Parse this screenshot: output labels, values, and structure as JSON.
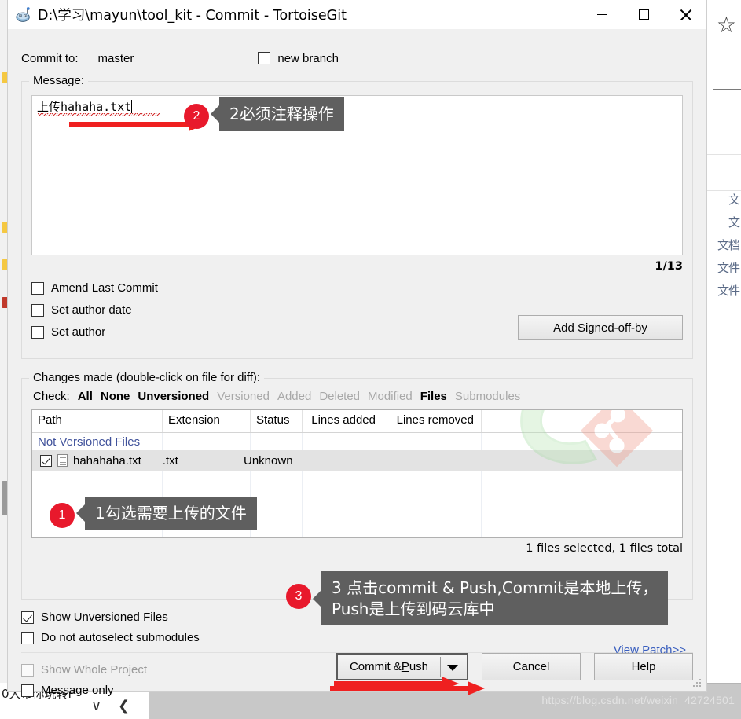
{
  "window": {
    "title": "D:\\学习\\mayun\\tool_kit - Commit - TortoiseGit",
    "app_icon": "tortoisegit-icon",
    "minimize_label": "minimize-icon",
    "maximize_label": "maximize-icon",
    "close_label": "close-icon"
  },
  "commit_to": {
    "label": "Commit to:",
    "branch": "master",
    "new_branch_label": "new branch",
    "new_branch_checked": false
  },
  "message": {
    "legend": "Message:",
    "value": "上传hahaha.txt",
    "counter": "1/13"
  },
  "options": {
    "amend_last_commit": "Amend Last Commit",
    "set_author_date": "Set author date",
    "set_author": "Set author",
    "add_signed_off_by": "Add Signed-off-by"
  },
  "changes": {
    "legend": "Changes made (double-click on file for diff):",
    "check_label": "Check:",
    "check_links": [
      {
        "label": "All",
        "state": "active"
      },
      {
        "label": "None",
        "state": "active"
      },
      {
        "label": "Unversioned",
        "state": "active"
      },
      {
        "label": "Versioned",
        "state": "dim"
      },
      {
        "label": "Added",
        "state": "dim"
      },
      {
        "label": "Deleted",
        "state": "dim"
      },
      {
        "label": "Modified",
        "state": "dim"
      },
      {
        "label": "Files",
        "state": "active"
      },
      {
        "label": "Submodules",
        "state": "dim"
      }
    ],
    "columns": [
      "Path",
      "Extension",
      "Status",
      "Lines added",
      "Lines removed"
    ],
    "group_header": "Not Versioned Files",
    "rows": [
      {
        "checked": true,
        "path": "hahahaha.txt",
        "extension": ".txt",
        "status": "Unknown",
        "lines_added": "",
        "lines_removed": ""
      }
    ],
    "files_total": "1 files selected, 1 files total",
    "view_patch": "View Patch>>"
  },
  "bottom_options": {
    "show_unversioned_files": {
      "label": "Show Unversioned Files",
      "checked": true,
      "disabled": false
    },
    "do_not_autoselect_submodules": {
      "label": "Do not autoselect submodules",
      "checked": false,
      "disabled": false
    },
    "show_whole_project": {
      "label": "Show Whole Project",
      "checked": false,
      "disabled": true
    },
    "message_only": {
      "label": "Message only",
      "checked": false,
      "disabled": false
    }
  },
  "actions": {
    "commit_push_prefix": "Commit & ",
    "commit_push_accel": "P",
    "commit_push_suffix": "ush",
    "dropdown_icon": "chevron-down-icon",
    "cancel": "Cancel",
    "help": "Help"
  },
  "annotations": [
    {
      "number": "1",
      "text": "1勾选需要上传的文件"
    },
    {
      "number": "2",
      "text": "2必须注释操作"
    },
    {
      "number": "3",
      "text": "3 点击commit & Push,Commit是本地上传，\nPush是上传到码云库中"
    }
  ],
  "backdrop": {
    "star_icon": "star-icon",
    "right_texts": [
      "文",
      "文",
      "文档",
      "文件",
      "文件"
    ],
    "taskbar_text": "0大带你玩转F",
    "dropdown_icon": "chevron-down-icon",
    "back_icon": "chevron-left-icon",
    "watermark": "https://blog.csdn.net/weixin_42724501"
  },
  "colors": {
    "accent_red": "#e8192c",
    "arrow_red": "#ef2020",
    "tooltip_bg": "#5f5f5f",
    "dialog_bg": "#f0f0f0",
    "link_blue": "#3a5fbf",
    "group_header_blue": "#40529b"
  }
}
